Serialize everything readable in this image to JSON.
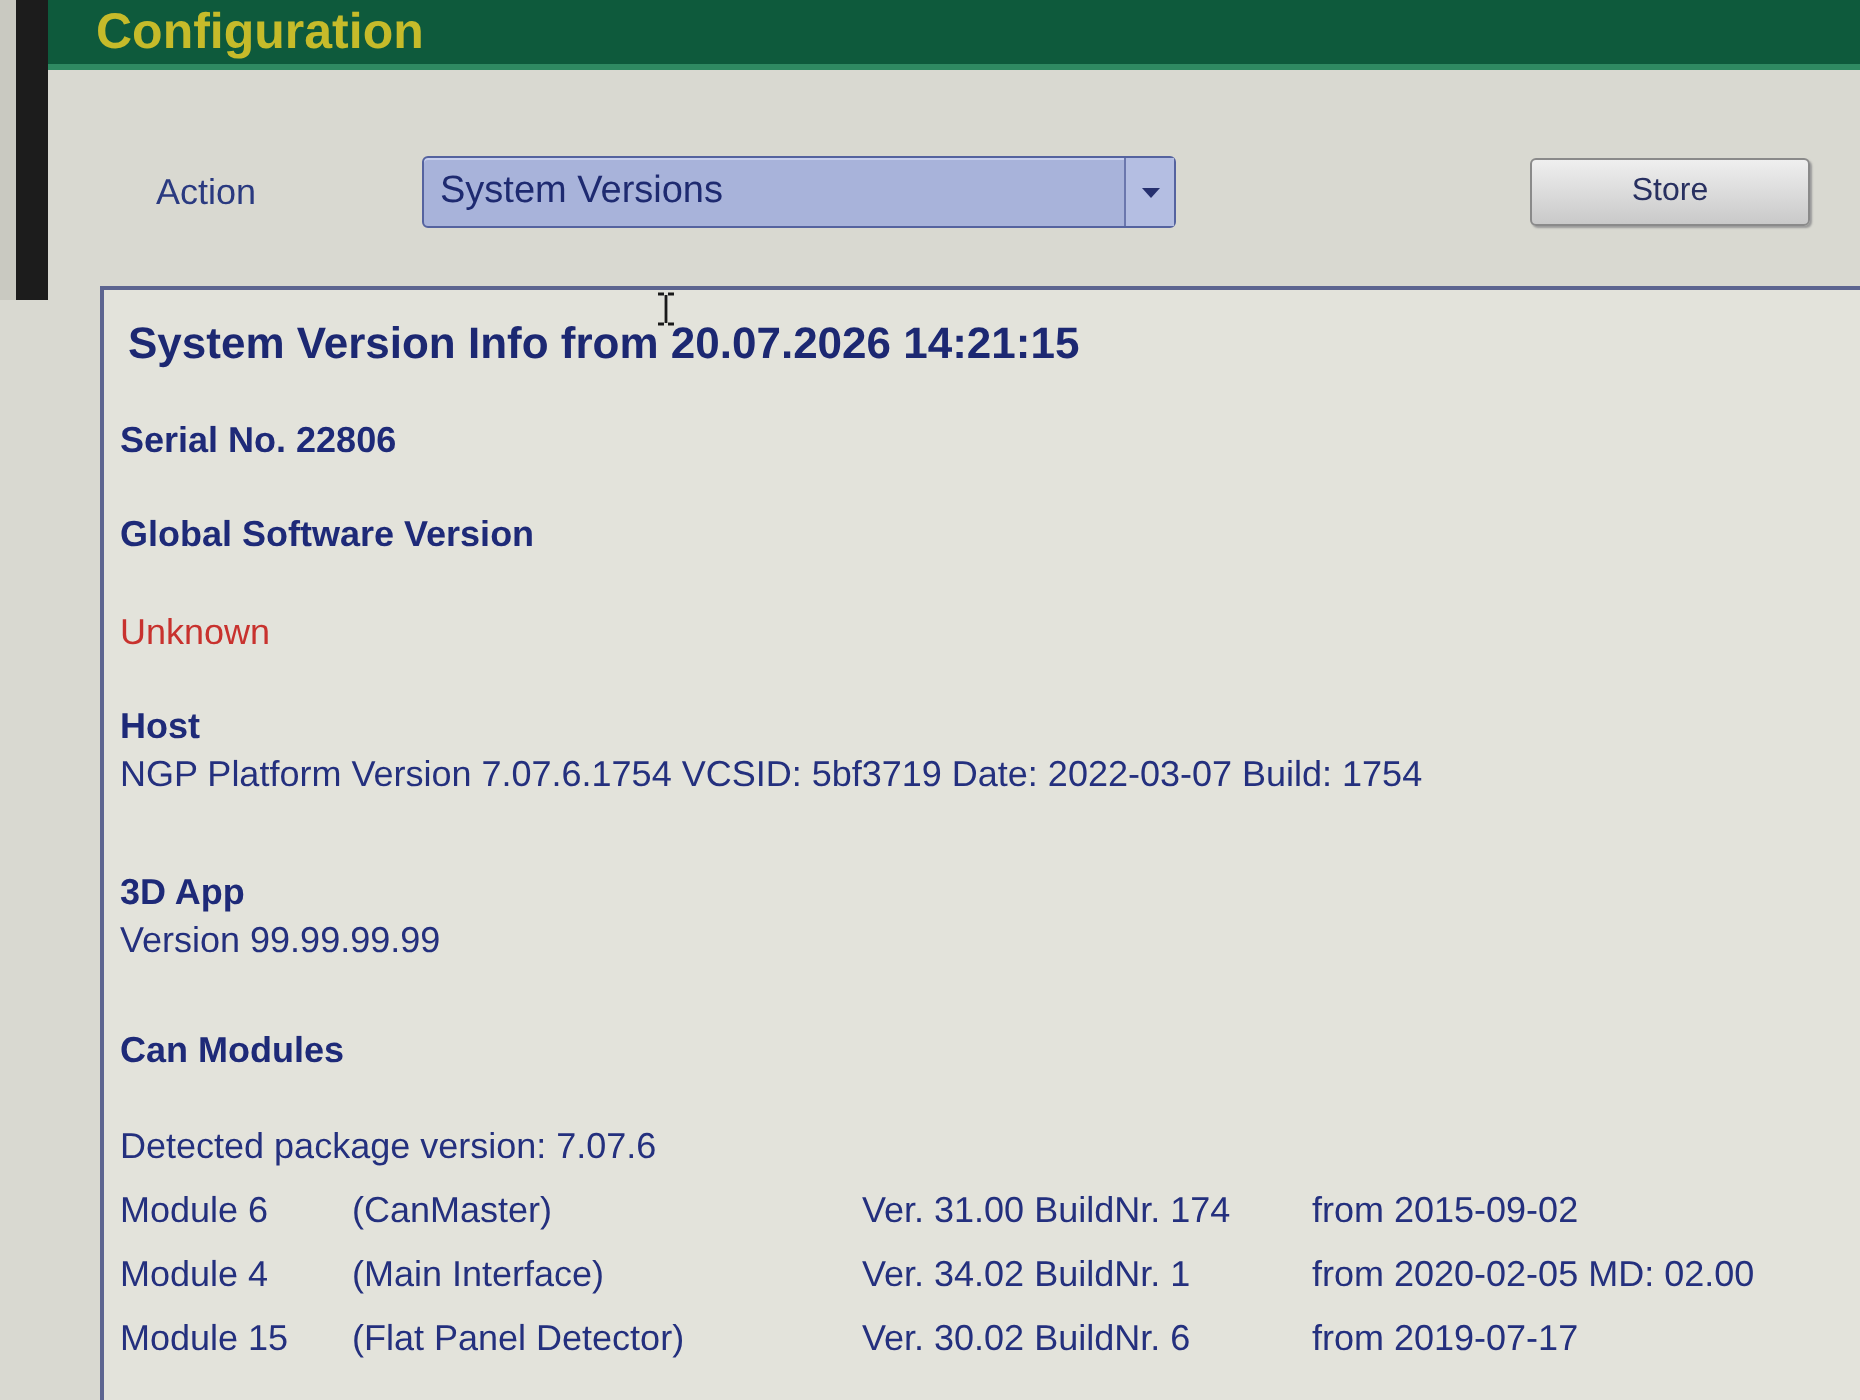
{
  "header": {
    "title": "Configuration"
  },
  "toolbar": {
    "action_label": "Action",
    "action_dropdown": {
      "value": "System Versions"
    },
    "store_button": "Store"
  },
  "info": {
    "title": "System Version Info from 20.07.2026 14:21:15",
    "serial": "Serial No. 22806",
    "sections": [
      {
        "heading": "Global Software Version",
        "lines": [
          {
            "text": "Unknown",
            "kind": "warning"
          }
        ]
      },
      {
        "heading": "Host",
        "lines": [
          {
            "text": "NGP Platform Version 7.07.6.1754 VCSID: 5bf3719 Date: 2022-03-07 Build: 1754",
            "kind": "normal"
          }
        ]
      },
      {
        "heading": "3D App",
        "lines": [
          {
            "text": "Version 99.99.99.99",
            "kind": "normal"
          }
        ]
      },
      {
        "heading": "Can Modules",
        "lines": [
          {
            "text": "Detected package version: 7.07.6",
            "kind": "package"
          }
        ],
        "modules": [
          {
            "module": "Module 6",
            "name": "(CanMaster)",
            "version": "Ver. 31.00 BuildNr. 174",
            "date": "from 2015-09-02"
          },
          {
            "module": "Module 4",
            "name": "(Main Interface)",
            "version": "Ver. 34.02 BuildNr. 1",
            "date": "from 2020-02-05 MD: 02.00"
          },
          {
            "module": "Module 15",
            "name": "(Flat Panel Detector)",
            "version": "Ver. 30.02 BuildNr. 6",
            "date": "from 2019-07-17"
          }
        ]
      }
    ]
  }
}
